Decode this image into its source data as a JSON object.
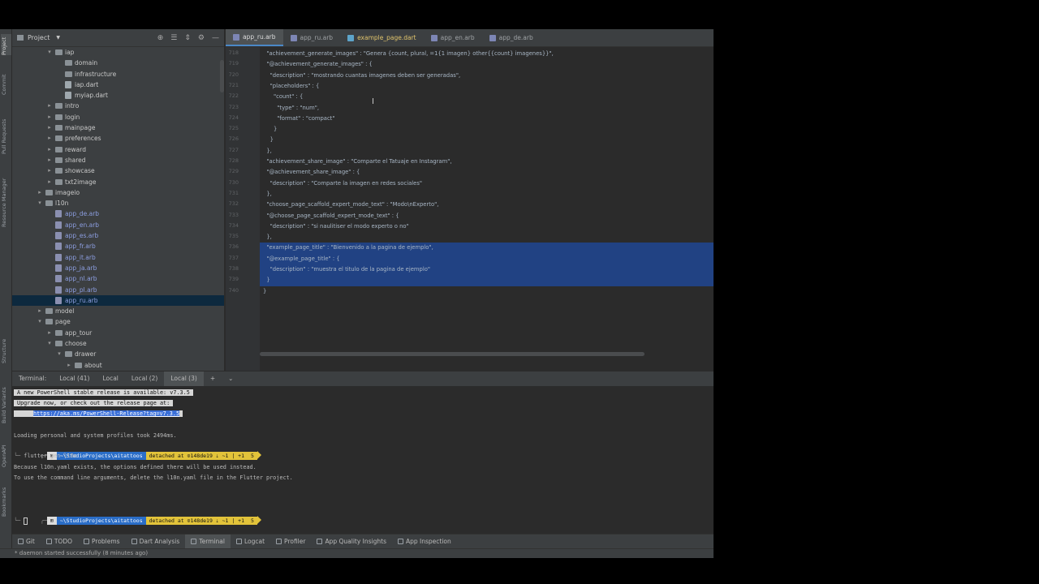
{
  "left_strip": {
    "project": "Project",
    "commit": "Commit",
    "pull_requests": "Pull Requests",
    "resource_manager": "Resource Manager",
    "structure": "Structure",
    "build_variants": "Build Variants",
    "openapi": "OpenAPI",
    "bookmarks": "Bookmarks"
  },
  "project_panel": {
    "title": "Project",
    "tree": [
      {
        "label": "iap",
        "depth": 3,
        "kind": "folder",
        "open": true
      },
      {
        "label": "domain",
        "depth": 4,
        "kind": "folder"
      },
      {
        "label": "infrastructure",
        "depth": 4,
        "kind": "folder"
      },
      {
        "label": "iap.dart",
        "depth": 4,
        "kind": "dart"
      },
      {
        "label": "myiap.dart",
        "depth": 4,
        "kind": "dart"
      },
      {
        "label": "intro",
        "depth": 3,
        "kind": "folder",
        "open": false
      },
      {
        "label": "login",
        "depth": 3,
        "kind": "folder",
        "open": false
      },
      {
        "label": "mainpage",
        "depth": 3,
        "kind": "folder",
        "open": false
      },
      {
        "label": "preferences",
        "depth": 3,
        "kind": "folder",
        "open": false
      },
      {
        "label": "reward",
        "depth": 3,
        "kind": "folder",
        "open": false
      },
      {
        "label": "shared",
        "depth": 3,
        "kind": "folder",
        "open": false
      },
      {
        "label": "showcase",
        "depth": 3,
        "kind": "folder",
        "open": false
      },
      {
        "label": "txt2image",
        "depth": 3,
        "kind": "folder",
        "open": false
      },
      {
        "label": "imageio",
        "depth": 2,
        "kind": "folder",
        "open": false
      },
      {
        "label": "l10n",
        "depth": 2,
        "kind": "folder",
        "open": true
      },
      {
        "label": "app_de.arb",
        "depth": 3,
        "kind": "arb"
      },
      {
        "label": "app_en.arb",
        "depth": 3,
        "kind": "arb"
      },
      {
        "label": "app_es.arb",
        "depth": 3,
        "kind": "arb"
      },
      {
        "label": "app_fr.arb",
        "depth": 3,
        "kind": "arb"
      },
      {
        "label": "app_it.arb",
        "depth": 3,
        "kind": "arb"
      },
      {
        "label": "app_ja.arb",
        "depth": 3,
        "kind": "arb"
      },
      {
        "label": "app_nl.arb",
        "depth": 3,
        "kind": "arb"
      },
      {
        "label": "app_pl.arb",
        "depth": 3,
        "kind": "arb"
      },
      {
        "label": "app_ru.arb",
        "depth": 3,
        "kind": "arb",
        "selected": true
      },
      {
        "label": "model",
        "depth": 2,
        "kind": "folder",
        "open": false
      },
      {
        "label": "page",
        "depth": 2,
        "kind": "folder",
        "open": true
      },
      {
        "label": "app_tour",
        "depth": 3,
        "kind": "folder",
        "open": false
      },
      {
        "label": "choose",
        "depth": 3,
        "kind": "folder",
        "open": true
      },
      {
        "label": "drawer",
        "depth": 4,
        "kind": "folder",
        "open": true
      },
      {
        "label": "about",
        "depth": 5,
        "kind": "folder",
        "open": false
      }
    ]
  },
  "editor": {
    "tabs": [
      {
        "label": "app_ru.arb",
        "icon": "arb",
        "active": true
      },
      {
        "label": "app_ru.arb",
        "icon": "arb"
      },
      {
        "label": "example_page.dart",
        "icon": "dart"
      },
      {
        "label": "app_en.arb",
        "icon": "arb"
      },
      {
        "label": "app_de.arb",
        "icon": "arb"
      }
    ],
    "lines": [
      {
        "n": "718",
        "text": "  \"achievement_generate_images\" : \"Genera {count, plural, =1{1 imagen} other{{count} imagenes}}\","
      },
      {
        "n": "719",
        "text": "  \"@achievement_generate_images\" : {"
      },
      {
        "n": "720",
        "text": "    \"description\" : \"mostrando cuantas imagenes deben ser generadas\","
      },
      {
        "n": "721",
        "text": "    \"placeholders\" : {"
      },
      {
        "n": "722",
        "text": "      \"count\" : {"
      },
      {
        "n": "723",
        "text": "        \"type\" : \"num\","
      },
      {
        "n": "724",
        "text": "        \"format\" : \"compact\""
      },
      {
        "n": "725",
        "text": "      }"
      },
      {
        "n": "726",
        "text": "    }"
      },
      {
        "n": "727",
        "text": "  },"
      },
      {
        "n": "728",
        "text": "  \"achievement_share_image\" : \"Comparte el Tatuaje en Instagram\","
      },
      {
        "n": "729",
        "text": "  \"@achievement_share_image\" : {"
      },
      {
        "n": "730",
        "text": "    \"description\" : \"Comparte la imagen en redes sociales\""
      },
      {
        "n": "731",
        "text": "  },"
      },
      {
        "n": "732",
        "text": "  \"choose_page_scaffold_expert_mode_text\" : \"Modo\\nExperto\","
      },
      {
        "n": "733",
        "text": "  \"@choose_page_scaffold_expert_mode_text\" : {"
      },
      {
        "n": "734",
        "text": "    \"description\" : \"si naulitiser el modo experto o no\""
      },
      {
        "n": "735",
        "text": "  },"
      },
      {
        "n": "736",
        "text": "  \"example_page_title\" : \"Bienvenido a la pagina de ejemplo\",",
        "sel": true
      },
      {
        "n": "737",
        "text": "  \"@example_page_title\" : {",
        "sel": true
      },
      {
        "n": "738",
        "text": "    \"description\" : \"muestra el titulo de la pagina de ejemplo\"",
        "sel": true
      },
      {
        "n": "739",
        "text": "  }",
        "sel": true
      },
      {
        "n": "740",
        "text": "}"
      }
    ]
  },
  "terminal": {
    "label": "Terminal:",
    "tabs": [
      "Local (41)",
      "Local",
      "Local (2)",
      "Local (3)"
    ],
    "active_tab": 3,
    "add_label": "+",
    "dropdown": "⌄",
    "notice": [
      "A new PowerShell stable release is available: v7.3.5",
      "Upgrade now, or check out the release page at:",
      "https://aka.ms/PowerShell-Release?tag=v7.3.5"
    ],
    "loading": "Loading personal and system profiles took 2494ms.",
    "prompt_path": "~\\StudioProjects\\aitattoos",
    "prompt_git": "detached at ⊙148de19 ⇣ ~1 | +1",
    "prompt_count": "5",
    "command": "flutter gen-l10n",
    "output": [
      "Because l10n.yaml exists, the options defined there will be used instead.",
      "To use the command line arguments, delete the l10n.yaml file in the Flutter project."
    ]
  },
  "tool_windows": [
    {
      "label": "Git",
      "icon": "git-icon"
    },
    {
      "label": "TODO",
      "icon": "list-icon"
    },
    {
      "label": "Problems",
      "icon": "warning-icon"
    },
    {
      "label": "Dart Analysis",
      "icon": "dart-icon"
    },
    {
      "label": "Terminal",
      "icon": "terminal-icon",
      "active": true
    },
    {
      "label": "Logcat",
      "icon": "logcat-icon"
    },
    {
      "label": "Profiler",
      "icon": "profiler-icon"
    },
    {
      "label": "App Quality Insights",
      "icon": "insights-icon"
    },
    {
      "label": "App Inspection",
      "icon": "inspection-icon"
    }
  ],
  "status": "* daemon started successfully (8 minutes ago)"
}
